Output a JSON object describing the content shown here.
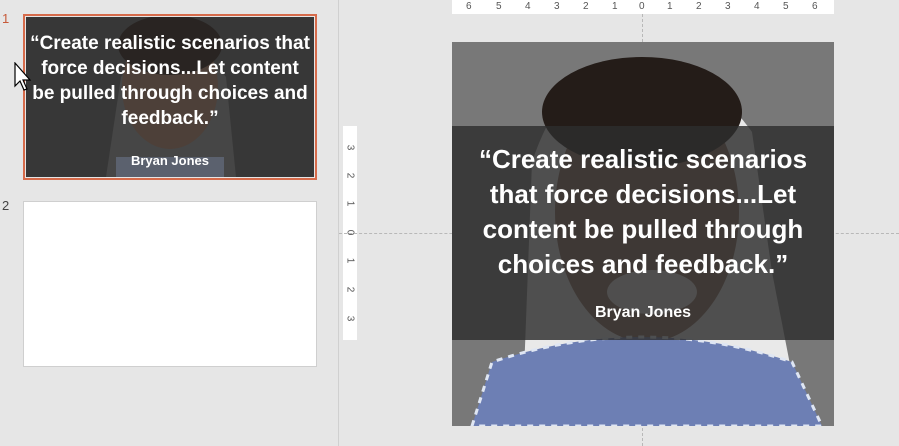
{
  "slides": [
    {
      "number": "1",
      "quote": "“Create realistic scenarios that force decisions...Let content be pulled through choices and feedback.”",
      "author": "Bryan Jones"
    },
    {
      "number": "2"
    }
  ],
  "editor": {
    "quote": "“Create realistic scenarios that force decisions...Let content be pulled through choices and feedback.”",
    "author": "Bryan Jones"
  },
  "ruler_h": [
    "6",
    "5",
    "4",
    "3",
    "2",
    "1",
    "0",
    "1",
    "2",
    "3",
    "4",
    "5",
    "6"
  ],
  "ruler_v": [
    "3",
    "2",
    "1",
    "0",
    "1",
    "2",
    "3"
  ],
  "colors": {
    "selection": "#d66b4b",
    "pane_bg": "#e6e6e6"
  }
}
